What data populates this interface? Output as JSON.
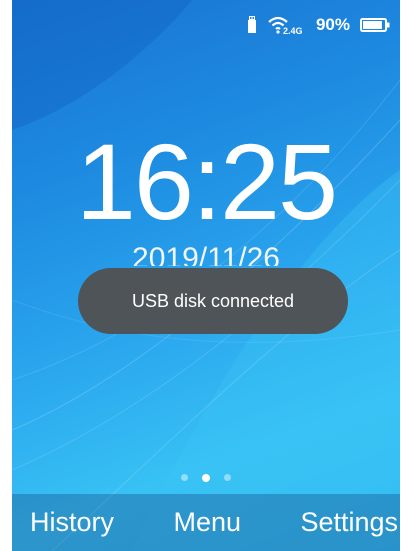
{
  "status_bar": {
    "usb_icon": "usb-drive-icon",
    "wifi_icon": "wifi-icon",
    "wifi_band": "2.4G",
    "battery_percent": "90%",
    "battery_level": 0.9,
    "battery_icon": "battery-icon"
  },
  "clock": {
    "time": "16:25",
    "date": "2019/11/26"
  },
  "toast": {
    "message": "USB disk connected"
  },
  "pager": {
    "pages": 3,
    "active_index": 1
  },
  "softkeys": {
    "left": "History",
    "center": "Menu",
    "right": "Settings"
  }
}
